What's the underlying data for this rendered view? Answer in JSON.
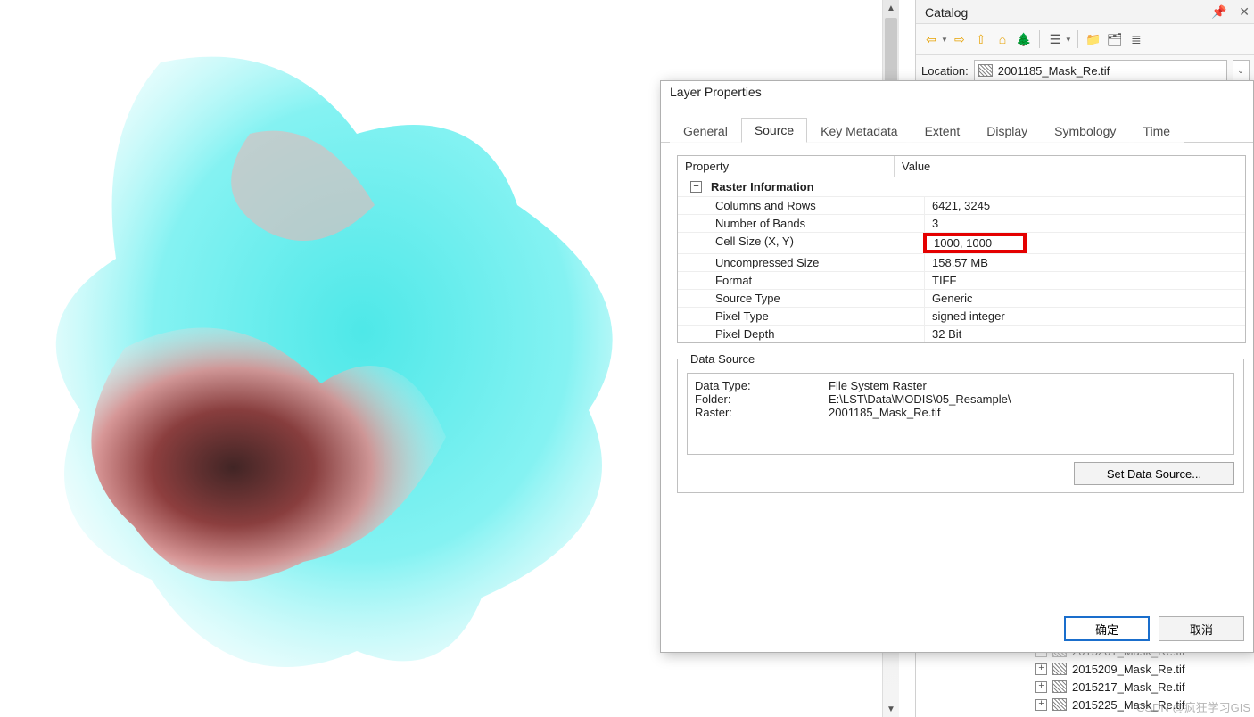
{
  "catalog": {
    "title": "Catalog",
    "location_label": "Location:",
    "location_value": "2001185_Mask_Re.tif",
    "toolbar_icons": [
      "back",
      "fwd",
      "up",
      "home",
      "tree",
      "list",
      "connect",
      "tool",
      "props"
    ],
    "tree_items": [
      "2015201_Mask_Re.tif",
      "2015209_Mask_Re.tif",
      "2015217_Mask_Re.tif",
      "2015225_Mask_Re.tif"
    ]
  },
  "dialog": {
    "title": "Layer Properties",
    "tabs": [
      "General",
      "Source",
      "Key Metadata",
      "Extent",
      "Display",
      "Symbology",
      "Time"
    ],
    "active_tab": "Source",
    "prop_header_property": "Property",
    "prop_header_value": "Value",
    "group_label": "Raster Information",
    "rows": [
      {
        "k": "Columns and Rows",
        "v": "6421, 3245"
      },
      {
        "k": "Number of Bands",
        "v": "3"
      },
      {
        "k": "Cell Size (X, Y)",
        "v": "1000, 1000"
      },
      {
        "k": "Uncompressed Size",
        "v": "158.57 MB"
      },
      {
        "k": "Format",
        "v": "TIFF"
      },
      {
        "k": "Source Type",
        "v": "Generic"
      },
      {
        "k": "Pixel Type",
        "v": "signed integer"
      },
      {
        "k": "Pixel Depth",
        "v": "32 Bit"
      }
    ],
    "ds_legend": "Data Source",
    "ds_rows": [
      {
        "k": "Data Type:",
        "v": "File System Raster"
      },
      {
        "k": "Folder:",
        "v": "E:\\LST\\Data\\MODIS\\05_Resample\\"
      },
      {
        "k": "Raster:",
        "v": "2001185_Mask_Re.tif"
      }
    ],
    "set_ds_btn": "Set Data Source...",
    "ok": "确定",
    "cancel": "取消"
  },
  "watermark": "CSDN @疯狂学习GIS"
}
